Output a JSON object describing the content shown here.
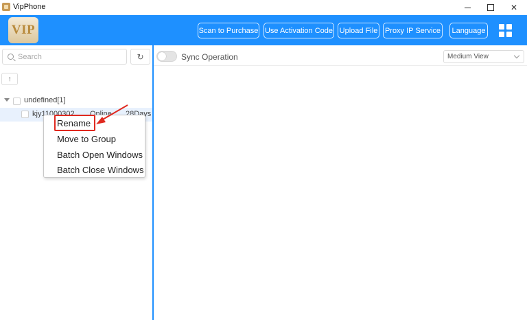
{
  "window": {
    "title": "VipPhone",
    "close_glyph": "✕"
  },
  "toolbar": {
    "logo_text": "VIP",
    "buttons": [
      {
        "label": "Scan to Purchase"
      },
      {
        "label": "Use Activation Code"
      },
      {
        "label": "Upload File"
      },
      {
        "label": "Proxy IP Service"
      },
      {
        "label": "Language"
      }
    ],
    "layout_icon": "grid-icon"
  },
  "sidebar": {
    "search": {
      "placeholder": "Search",
      "value": ""
    },
    "refresh_glyph": "↻",
    "sort_glyph": "↑",
    "group": {
      "label": "undefined[1]"
    },
    "device": {
      "name": "kjy11000302",
      "status": "Online",
      "days": "28Days"
    }
  },
  "context_menu": {
    "items": [
      {
        "label": "Rename"
      },
      {
        "label": "Move to Group"
      },
      {
        "label": "Batch Open Windows"
      },
      {
        "label": "Batch Close Windows"
      }
    ]
  },
  "main": {
    "sync_label": "Sync Operation",
    "sync_enabled": false,
    "view_select": "Medium View"
  },
  "colors": {
    "toolbar_bg": "#1e90ff",
    "annotation": "#e0291f",
    "selected_row": "#e8f1fd"
  }
}
